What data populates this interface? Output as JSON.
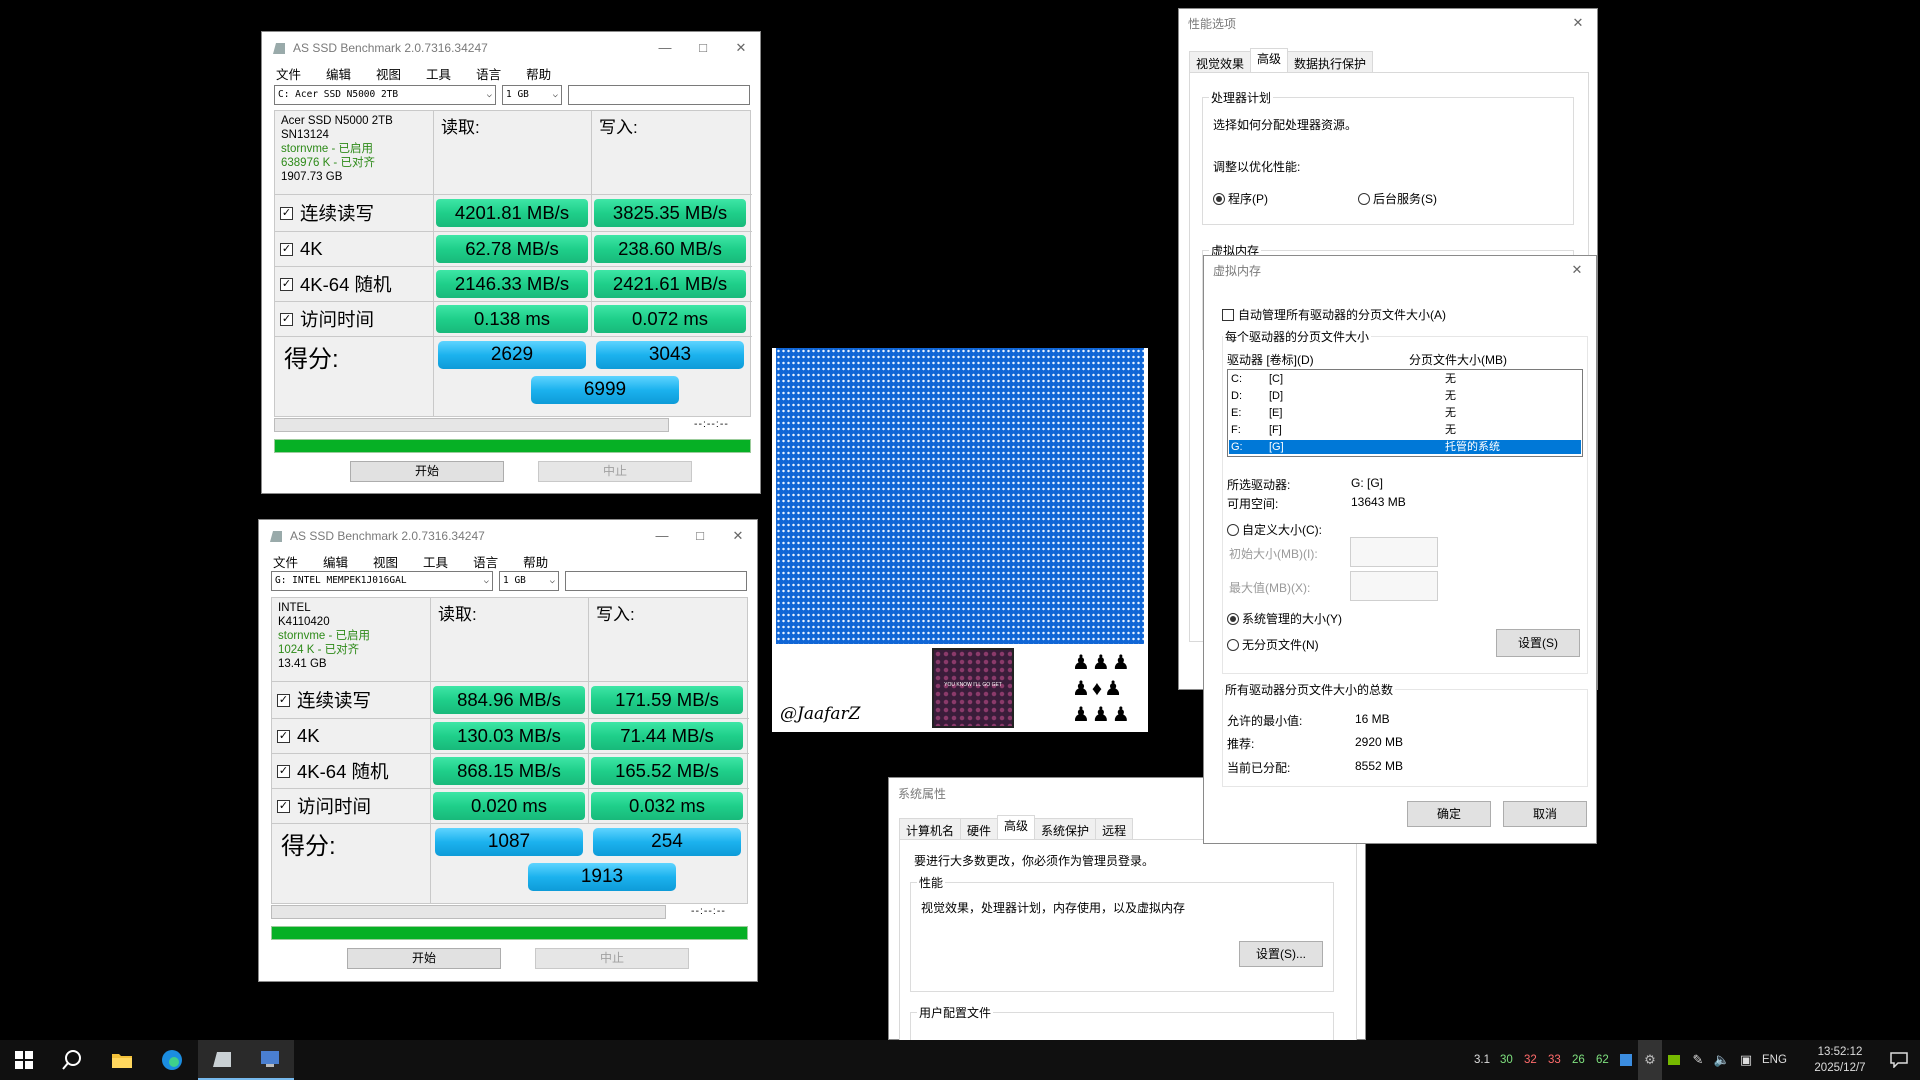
{
  "bench1": {
    "title": "AS SSD Benchmark 2.0.7316.34247",
    "menu": [
      "文件",
      "编辑",
      "视图",
      "工具",
      "语言",
      "帮助"
    ],
    "drive_select": "C: Acer SSD N5000 2TB",
    "size_select": "1 GB",
    "info": {
      "name": "Acer SSD N5000 2TB",
      "fw": "SN13124",
      "driver": "stornvme - 已启用",
      "align": "638976 K - 已对齐",
      "capacity": "1907.73 GB"
    },
    "read_header": "读取:",
    "write_header": "写入:",
    "rows": [
      {
        "label": "连续读写",
        "read": "4201.81 MB/s",
        "write": "3825.35 MB/s"
      },
      {
        "label": "4K",
        "read": "62.78 MB/s",
        "write": "238.60 MB/s"
      },
      {
        "label": "4K-64 随机",
        "read": "2146.33 MB/s",
        "write": "2421.61 MB/s"
      },
      {
        "label": "访问时间",
        "read": "0.138 ms",
        "write": "0.072 ms"
      }
    ],
    "score_label": "得分:",
    "score_read": "2629",
    "score_write": "3043",
    "score_total": "6999",
    "timer": "--:--:--",
    "progress": 1.0,
    "start": "开始",
    "stop": "中止"
  },
  "bench2": {
    "title": "AS SSD Benchmark 2.0.7316.34247",
    "menu": [
      "文件",
      "编辑",
      "视图",
      "工具",
      "语言",
      "帮助"
    ],
    "drive_select": "G: INTEL MEMPEK1J016GAL",
    "size_select": "1 GB",
    "info": {
      "name": "INTEL",
      "fw": "K4110420",
      "driver": "stornvme - 已启用",
      "align": "1024 K - 已对齐",
      "capacity": "13.41 GB"
    },
    "read_header": "读取:",
    "write_header": "写入:",
    "rows": [
      {
        "label": "连续读写",
        "read": "884.96 MB/s",
        "write": "171.59 MB/s"
      },
      {
        "label": "4K",
        "read": "130.03 MB/s",
        "write": "71.44 MB/s"
      },
      {
        "label": "4K-64 随机",
        "read": "868.15 MB/s",
        "write": "165.52 MB/s"
      },
      {
        "label": "访问时间",
        "read": "0.020 ms",
        "write": "0.032 ms"
      }
    ],
    "score_label": "得分:",
    "score_read": "1087",
    "score_write": "254",
    "score_total": "1913",
    "timer": "--:--:--",
    "progress": 1.0,
    "start": "开始",
    "stop": "中止"
  },
  "art": {
    "signature": "@JaafarZ",
    "poster_text": "YOU KNOW I'LL GO GET"
  },
  "perf": {
    "title": "性能选项",
    "tabs": [
      "视觉效果",
      "高级",
      "数据执行保护"
    ],
    "cpu_group": "处理器计划",
    "cpu_desc": "选择如何分配处理器资源。",
    "adjust": "调整以优化性能:",
    "opt_programs": "程序(P)",
    "opt_services": "后台服务(S)",
    "vm_group": "虚拟内存"
  },
  "vm": {
    "title": "虚拟内存",
    "auto_manage": "自动管理所有驱动器的分页文件大小(A)",
    "per_drive": "每个驱动器的分页文件大小",
    "col_drive": "驱动器 [卷标](D)",
    "col_size": "分页文件大小(MB)",
    "drives": [
      {
        "letter": "C:",
        "label": "[C]",
        "size": "无"
      },
      {
        "letter": "D:",
        "label": "[D]",
        "size": "无"
      },
      {
        "letter": "E:",
        "label": "[E]",
        "size": "无"
      },
      {
        "letter": "F:",
        "label": "[F]",
        "size": "无"
      },
      {
        "letter": "G:",
        "label": "[G]",
        "size": "托管的系统"
      }
    ],
    "selected_label": "所选驱动器:",
    "selected_value": "G:  [G]",
    "free_label": "可用空间:",
    "free_value": "13643 MB",
    "custom": "自定义大小(C):",
    "initial": "初始大小(MB)(I):",
    "max": "最大值(MB)(X):",
    "system_managed": "系统管理的大小(Y)",
    "no_paging": "无分页文件(N)",
    "set_btn": "设置(S)",
    "total_group": "所有驱动器分页文件大小的总数",
    "min_label": "允许的最小值:",
    "min_value": "16 MB",
    "rec_label": "推荐:",
    "rec_value": "2920 MB",
    "cur_label": "当前已分配:",
    "cur_value": "8552 MB",
    "ok": "确定",
    "cancel": "取消"
  },
  "sysprops": {
    "title": "系统属性",
    "tabs": [
      "计算机名",
      "硬件",
      "高级",
      "系统保护",
      "远程"
    ],
    "admin_note": "要进行大多数更改，你必须作为管理员登录。",
    "perf_group": "性能",
    "perf_desc": "视觉效果，处理器计划，内存使用，以及虚拟内存",
    "settings_btn": "设置(S)...",
    "profile_group": "用户配置文件"
  },
  "taskbar": {
    "tray_numbers": [
      "3.1",
      "30",
      "32",
      "33",
      "26",
      "62"
    ],
    "lang": "ENG",
    "time": "13:52:12",
    "date": "2025/12/7"
  }
}
